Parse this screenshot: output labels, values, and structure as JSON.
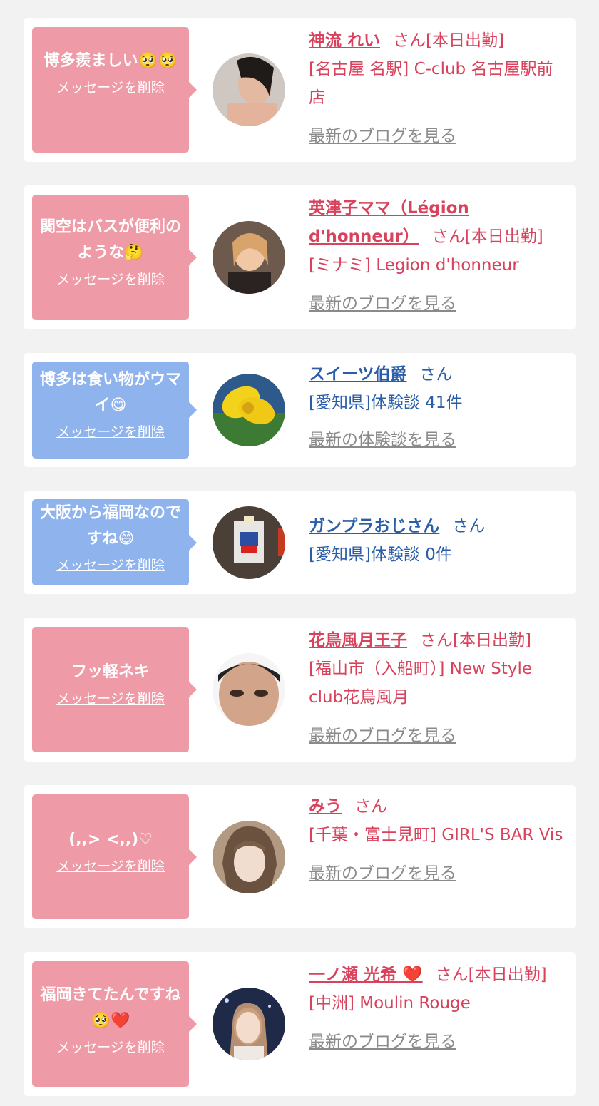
{
  "delete_label": "メッセージを削除",
  "cards": [
    {
      "message": "博多羨ましい🥺🥺",
      "name": "神流 れい",
      "suffix": "さん[本日出勤]",
      "detail": "[名古屋 名駅] C-club 名古屋駅前店",
      "link": "最新のブログを見る"
    },
    {
      "message": "関空はバスが便利のような🤔",
      "name": "英津子ママ（Légion d'honneur）",
      "suffix": "さん[本日出勤]",
      "detail": "[ミナミ] Legion d'honneur",
      "link": "最新のブログを見る"
    },
    {
      "message": "博多は食い物がウマイ😋",
      "name": "スイーツ伯爵",
      "suffix": "さん",
      "detail": "[愛知県]体験談 41件",
      "link": "最新の体験談を見る"
    },
    {
      "message": "大阪から福岡なのですね😄",
      "name": "ガンプラおじさん",
      "suffix": "さん",
      "detail": "[愛知県]体験談 0件",
      "link": ""
    },
    {
      "message": "フッ軽ネキ",
      "name": "花鳥風月王子",
      "suffix": "さん[本日出勤]",
      "detail": "[福山市（入船町）] New Style club花鳥風月",
      "link": "最新のブログを見る"
    },
    {
      "message": "(,,> <,,)♡",
      "name": "みう",
      "suffix": "さん",
      "detail": "[千葉・富士見町] GIRL'S BAR Vis",
      "link": "最新のブログを見る"
    },
    {
      "message": "福岡きてたんですね🥺❤️",
      "name": "一ノ瀬 光希 ❤️",
      "suffix": "さん[本日出勤]",
      "detail": "[中洲] Moulin Rouge",
      "link": "最新のブログを見る"
    }
  ],
  "colors": {
    "pink_bubble": "#ef9aa7",
    "blue_bubble": "#8fb3ec",
    "pink_text": "#d8425c",
    "blue_text": "#2a5ea8"
  },
  "icons": [
    "avatar-1",
    "avatar-2",
    "avatar-3",
    "avatar-4",
    "avatar-5",
    "avatar-6",
    "avatar-7"
  ]
}
